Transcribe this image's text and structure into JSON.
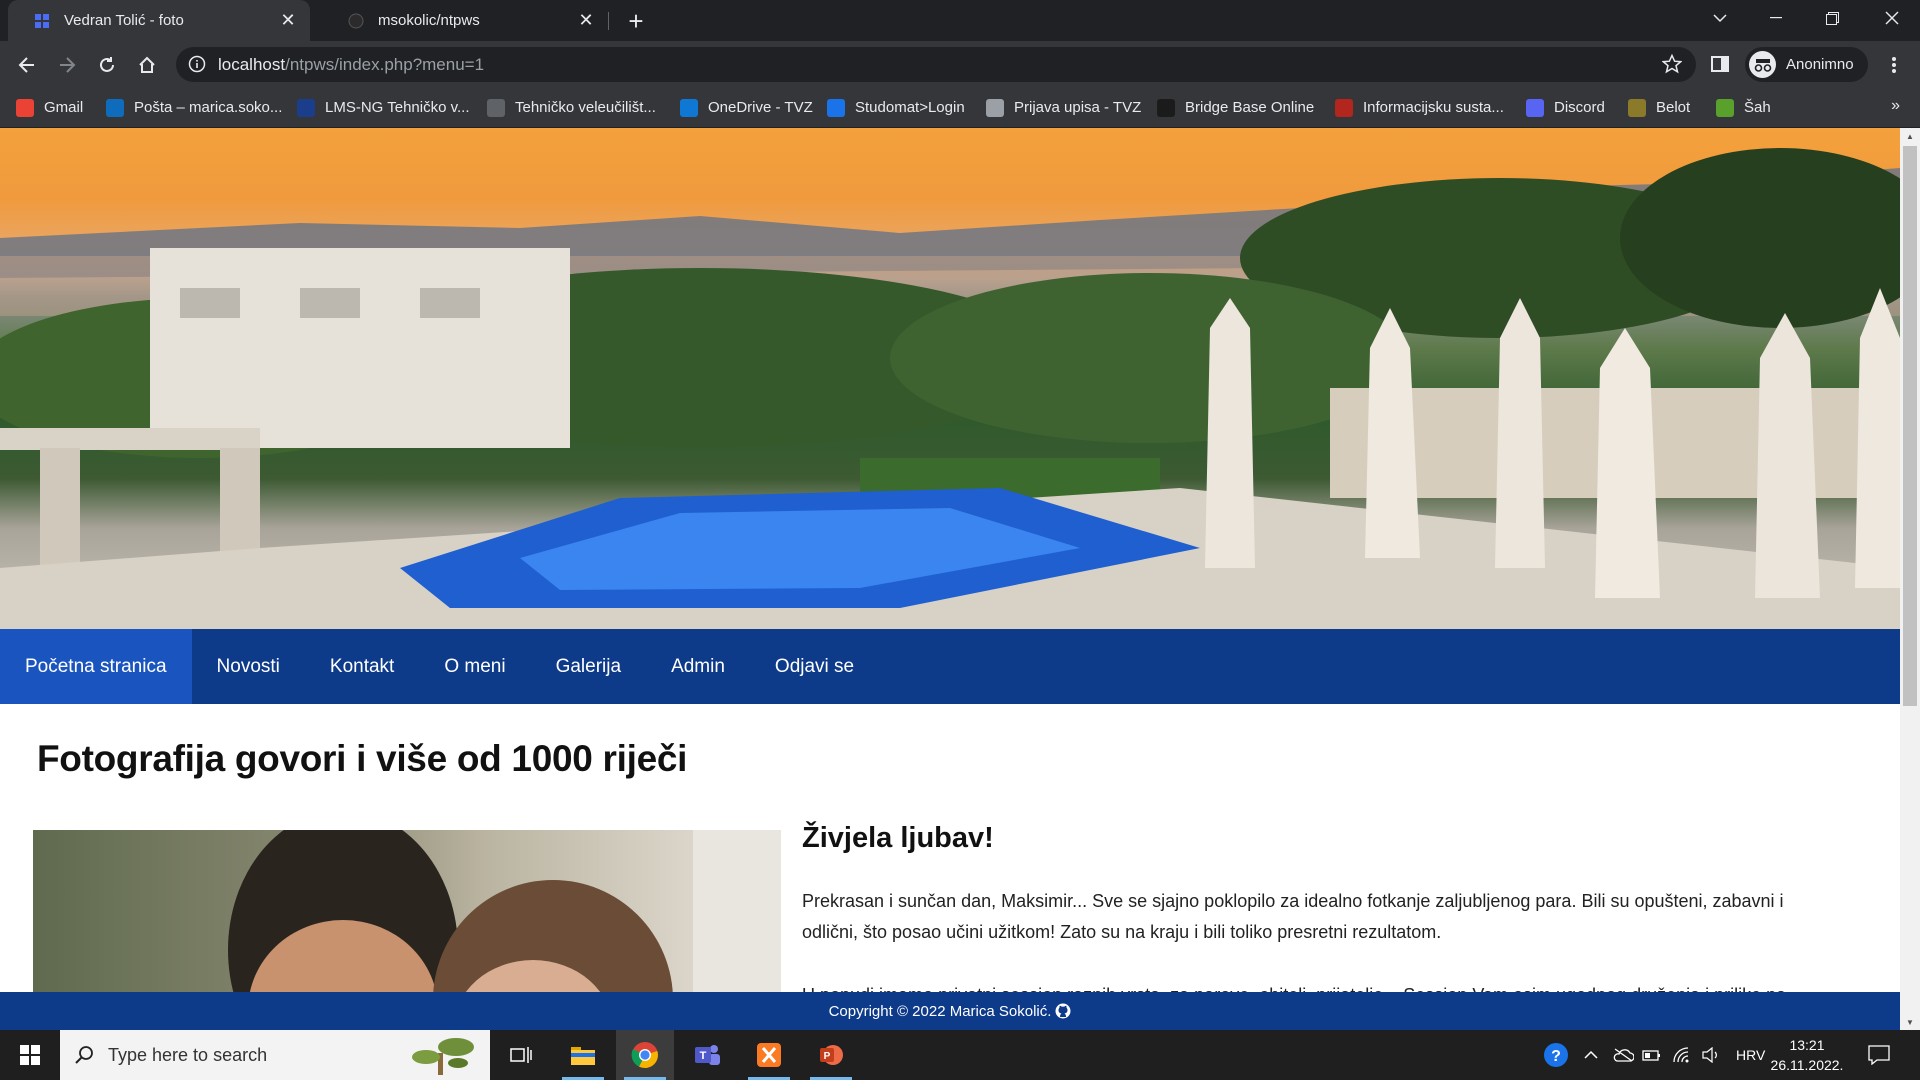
{
  "browser": {
    "tabs": [
      {
        "title": "Vedran Tolić - foto",
        "active": true
      },
      {
        "title": "msokolic/ntpws",
        "active": false
      }
    ],
    "address": {
      "host": "localhost",
      "path": "/ntpws/index.php?menu=1"
    },
    "profile_label": "Anonimno",
    "bookmarks": [
      {
        "label": "Gmail",
        "icon": "gmail-icon",
        "color": "#ea4335"
      },
      {
        "label": "Pošta – marica.soko...",
        "icon": "outlook-icon",
        "color": "#0f6cbd"
      },
      {
        "label": "LMS-NG Tehničko v...",
        "icon": "lms-icon",
        "color": "#1a3e8c"
      },
      {
        "label": "Tehničko veleučilišt...",
        "icon": "globe-icon",
        "color": "#5f6368"
      },
      {
        "label": "OneDrive - TVZ",
        "icon": "onedrive-icon",
        "color": "#0f78d4"
      },
      {
        "label": "Studomat>Login",
        "icon": "studomat-icon",
        "color": "#1a73e8"
      },
      {
        "label": "Prijava upisa - TVZ",
        "icon": "document-icon",
        "color": "#9aa0a6"
      },
      {
        "label": "Bridge Base Online",
        "icon": "bbo-icon",
        "color": "#1b1b1b"
      },
      {
        "label": "Informacijsku susta...",
        "icon": "info-system-icon",
        "color": "#b3261e"
      },
      {
        "label": "Discord",
        "icon": "discord-icon",
        "color": "#5865f2"
      },
      {
        "label": "Belot",
        "icon": "belot-icon",
        "color": "#8a7a2a"
      },
      {
        "label": "Šah",
        "icon": "chess-icon",
        "color": "#5aa02c"
      }
    ],
    "bookmarks_more": "»"
  },
  "site": {
    "nav": [
      "Početna stranica",
      "Novosti",
      "Kontakt",
      "O meni",
      "Galerija",
      "Admin",
      "Odjavi se"
    ],
    "active_nav": 0,
    "heading": "Fotografija govori i više od 1000 riječi",
    "article_title": "Živjela ljubav!",
    "article_text": "Prekrasan i sunčan dan, Maksimir... Sve se sjajno poklopilo za idealno fotkanje zaljubljenog para. Bili su opušteni, zabavni i odlični, što posao učini užitkom! Zato su na kraju i bili toliko presretni rezultatom.",
    "article_text_2": "U ponudi imamo privatni session raznih vrsta, za parove, obitelj, prijatelje... Session Vam osim ugodnog druženja i prilike na",
    "footer": "Copyright © 2022 Marica Sokolić."
  },
  "taskbar": {
    "search_placeholder": "Type here to search",
    "language": "HRV",
    "time": "13:21",
    "date": "26.11.2022."
  },
  "colors": {
    "nav": "#0e3a8a",
    "nav_active": "#1a55bf",
    "chrome_dark": "#202124",
    "chrome_mid": "#35363a"
  }
}
